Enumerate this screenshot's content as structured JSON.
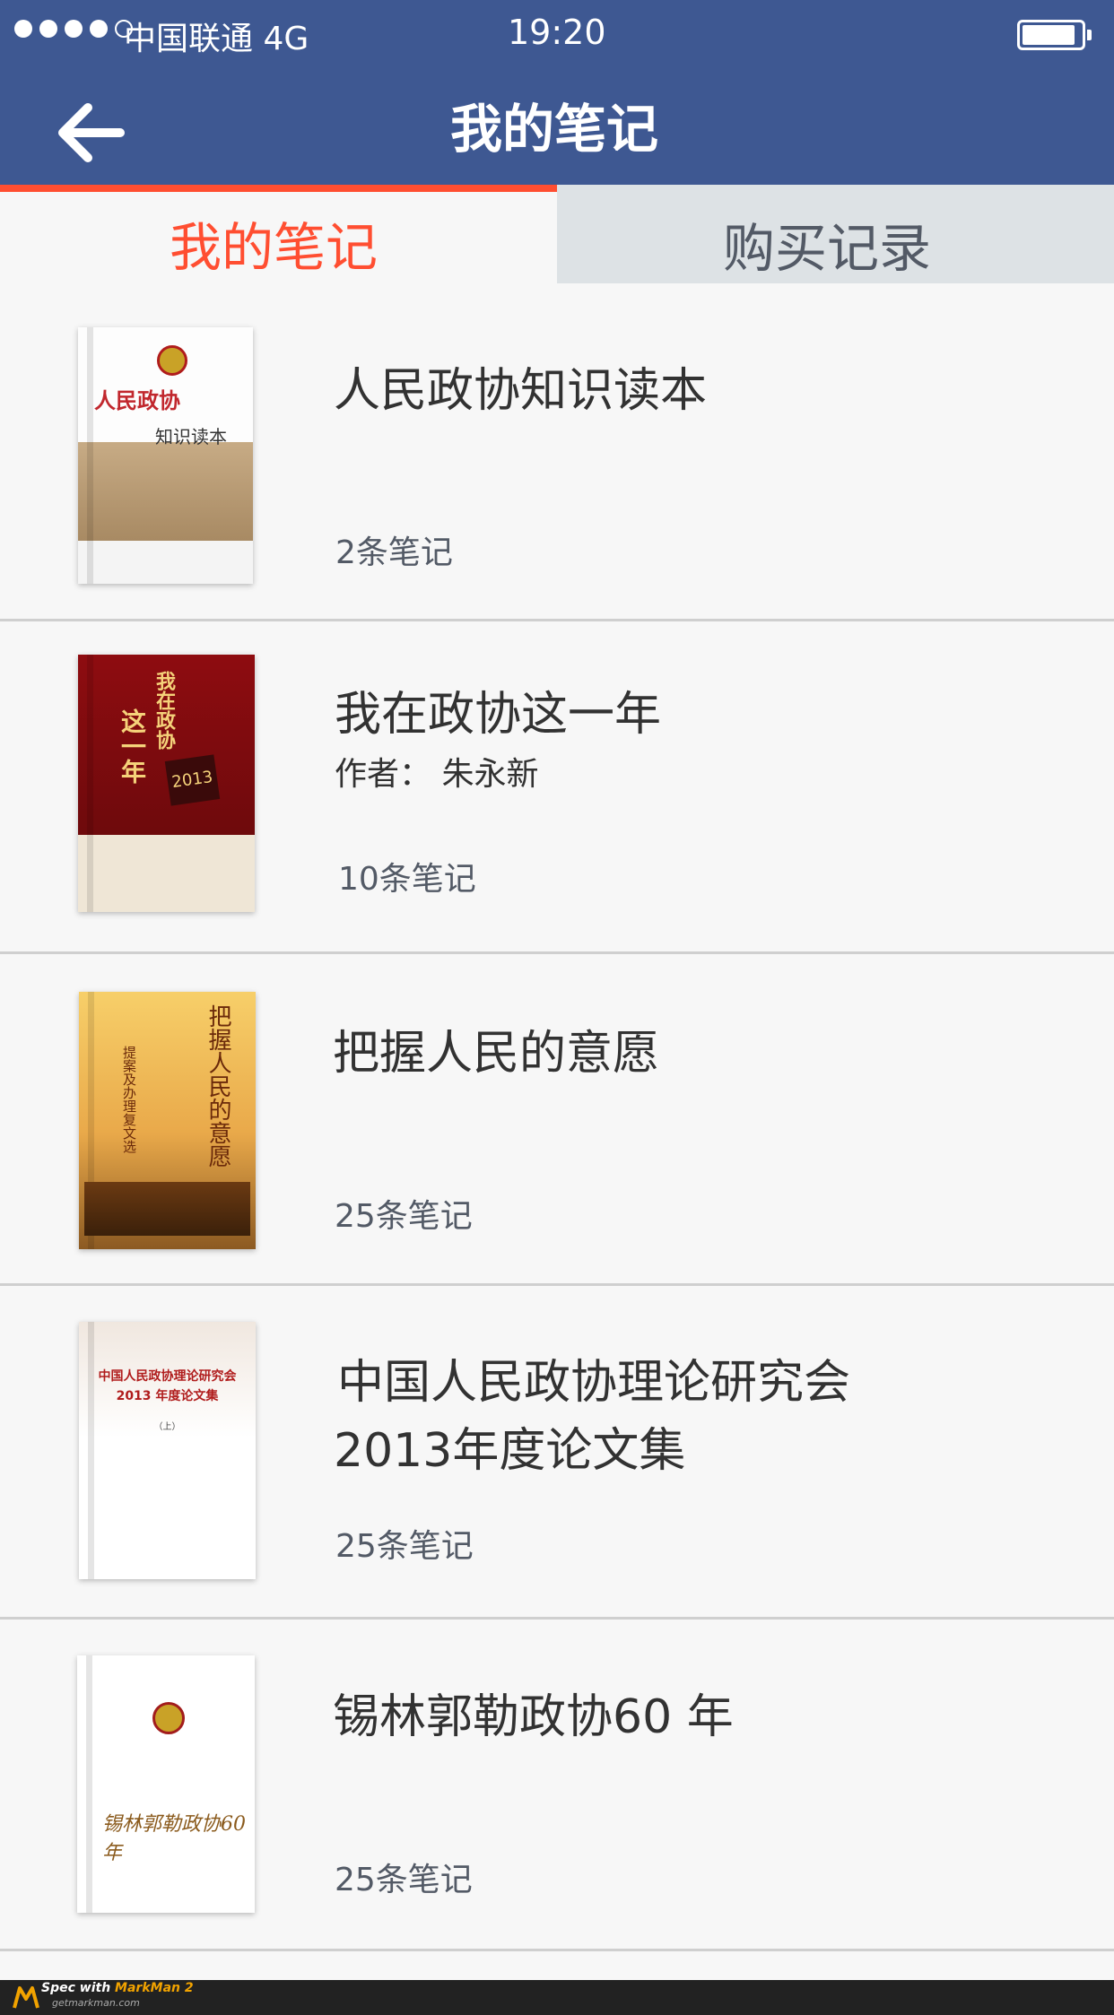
{
  "status_bar": {
    "carrier": "中国联通 4G",
    "time": "19:20"
  },
  "nav": {
    "title": "我的笔记",
    "back_icon": "back-arrow-icon"
  },
  "tabs": [
    {
      "label": "我的笔记",
      "active": true,
      "color": "#ff4e31"
    },
    {
      "label": "购买记录",
      "active": false,
      "color": "#535a66"
    }
  ],
  "books": [
    {
      "title": "人民政协知识读本",
      "notes": "2条笔记",
      "cover_lines": [
        "人民政协",
        "知识读本"
      ]
    },
    {
      "title": "我在政协这一年",
      "author": "作者：  朱永新",
      "notes": "10条笔记",
      "cover_lines": [
        "我在政协",
        "这一年",
        "2013"
      ]
    },
    {
      "title": "把握人民的意愿",
      "notes": "25条笔记",
      "cover_lines": [
        "把握人民的意愿",
        "提案及办理复文选"
      ]
    },
    {
      "title_lines": [
        "中国人民政协理论研究会",
        "2013年度论文集"
      ],
      "notes": "25条笔记",
      "cover_lines": [
        "中国人民政协理论研究会",
        "2013 年度论文集",
        "（上）"
      ]
    },
    {
      "title": "锡林郭勒政协60 年",
      "notes": "25条笔记",
      "cover_lines": [
        "锡林郭勒政协60年"
      ]
    }
  ],
  "footer": {
    "brand_prefix": "Spec with ",
    "brand_name": "MarkMan 2",
    "url": "getmarkman.com"
  },
  "colors": {
    "nav_bg": "#3e5892",
    "accent": "#ff4e31",
    "text_dark": "#323232",
    "text_gray": "#535a66"
  }
}
